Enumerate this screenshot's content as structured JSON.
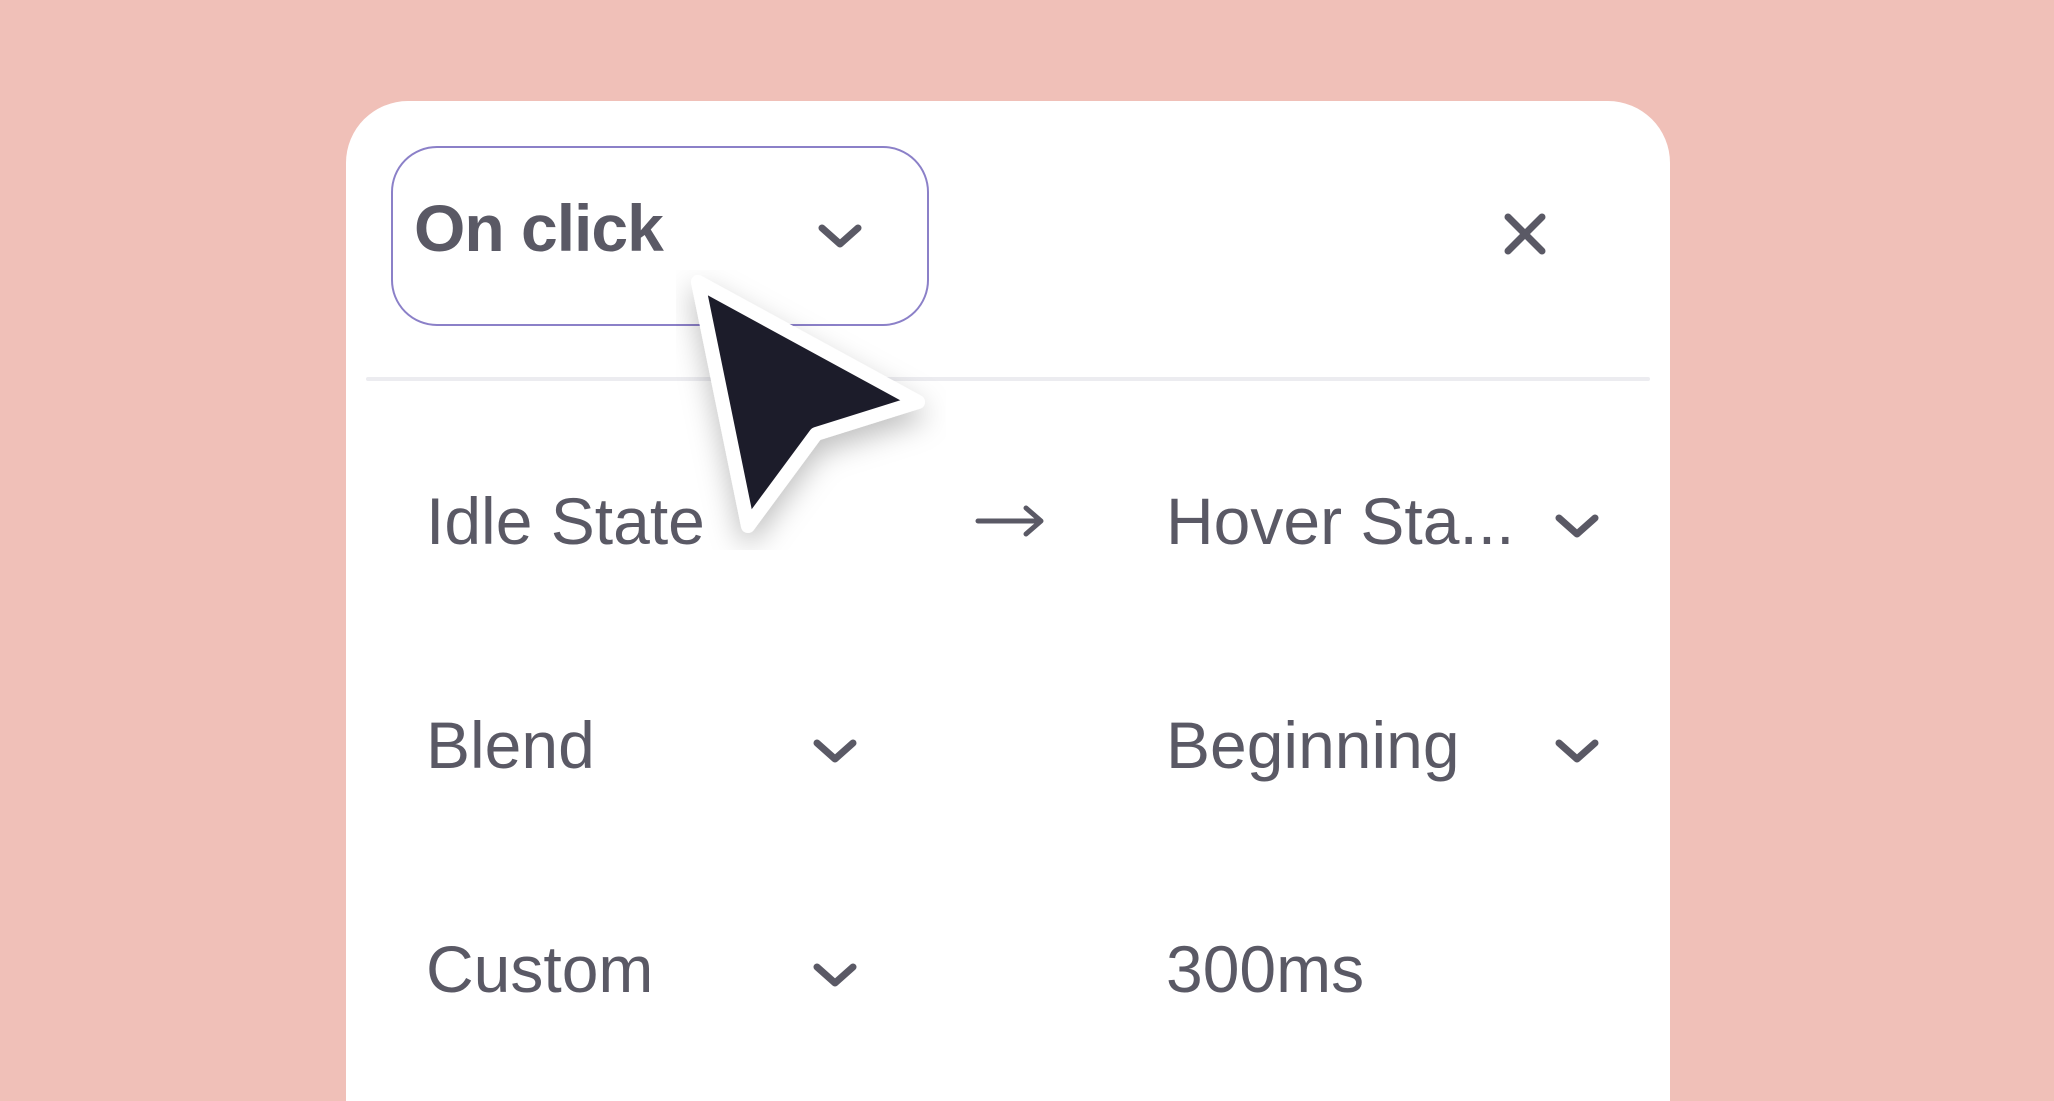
{
  "trigger": {
    "label": "On click",
    "chevron_icon": "chevron-down-icon"
  },
  "close": {
    "icon": "close-icon"
  },
  "transition": {
    "from_state": "Idle State",
    "arrow_icon": "arrow-right-icon",
    "to_state": "Hover Sta...",
    "to_state_chevron_icon": "chevron-down-icon"
  },
  "animation": {
    "type": "Blend",
    "type_chevron_icon": "chevron-down-icon",
    "timing": "Beginning",
    "timing_chevron_icon": "chevron-down-icon"
  },
  "easing": {
    "curve": "Custom",
    "curve_chevron_icon": "chevron-down-icon",
    "duration": "300ms"
  },
  "cursor": {
    "icon": "mouse-pointer-icon"
  },
  "colors": {
    "background": "#f0c0b8",
    "panel": "#ffffff",
    "text": "#5a5965",
    "trigger_border": "#8b80c8",
    "cursor": "#1e1c2a"
  }
}
